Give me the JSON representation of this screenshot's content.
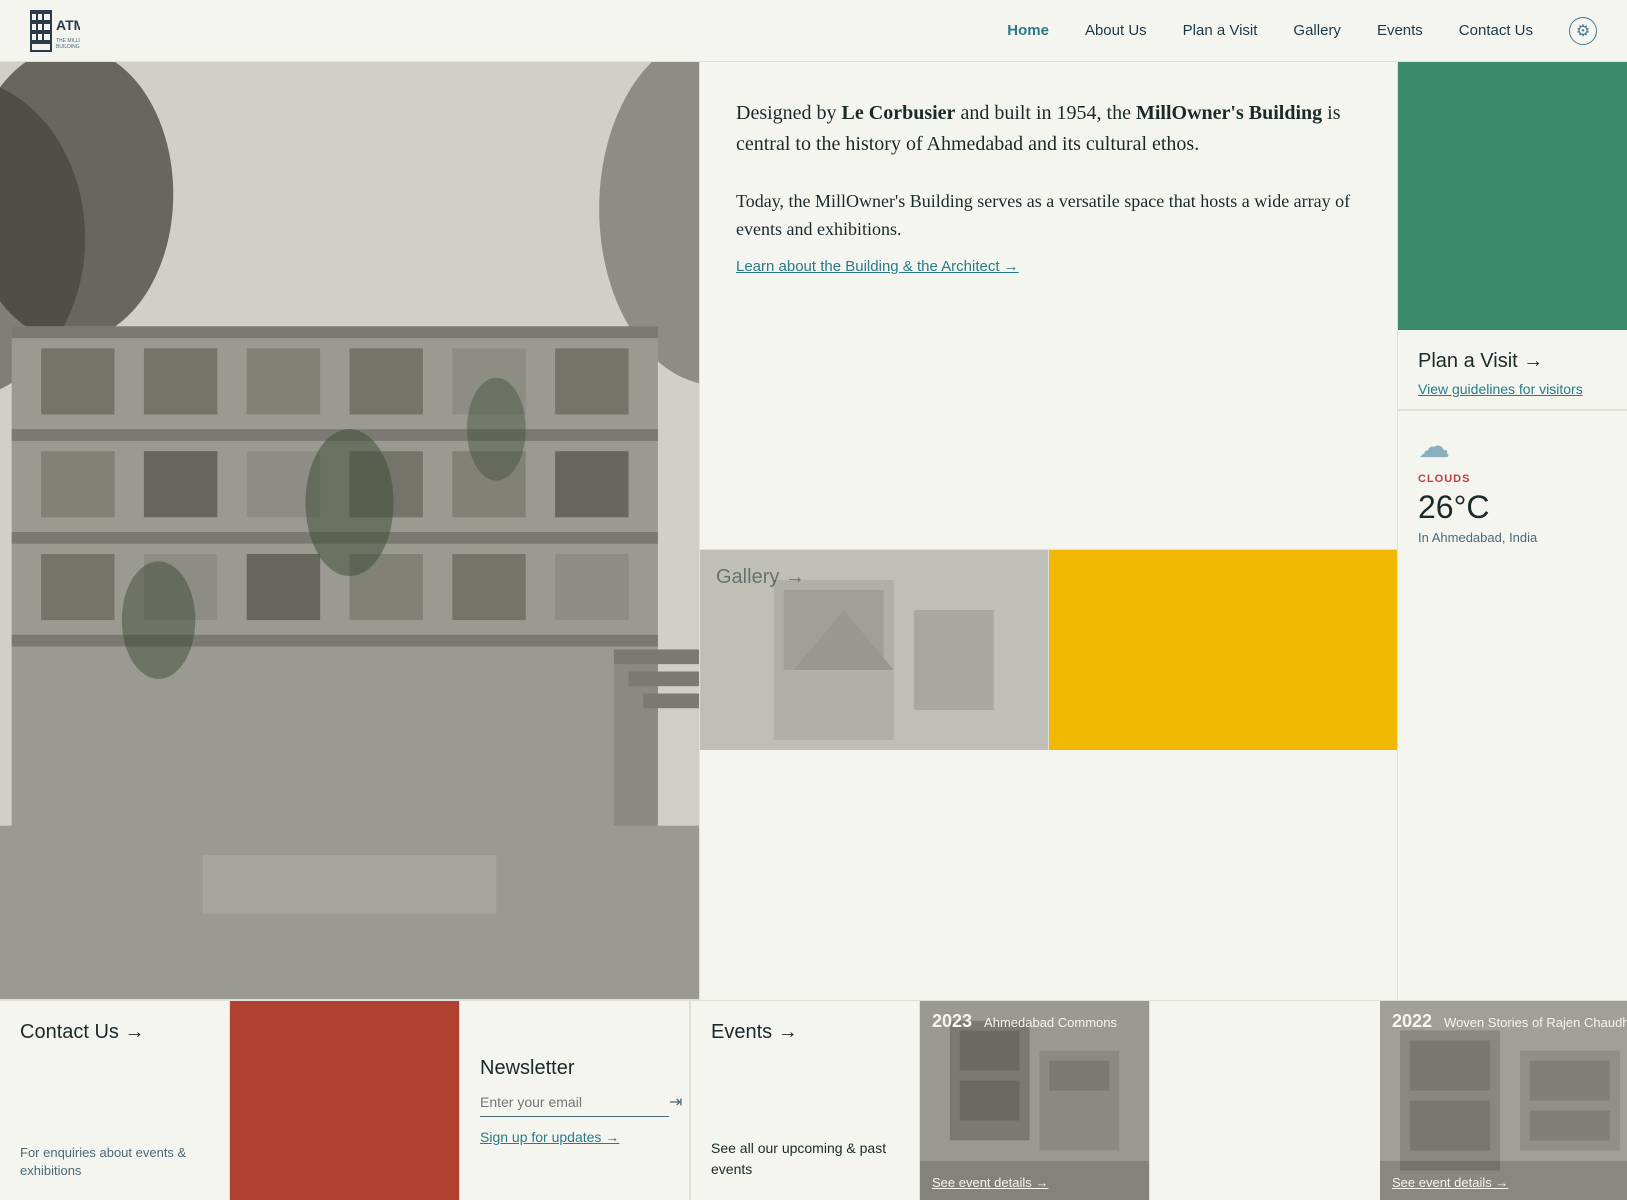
{
  "site": {
    "logo_text": "ATMA",
    "logo_subtitle": "THE MILLOWNER'S BUILDING"
  },
  "nav": {
    "items": [
      {
        "label": "Home",
        "active": true
      },
      {
        "label": "About Us",
        "active": false
      },
      {
        "label": "Plan a Visit",
        "active": false
      },
      {
        "label": "Gallery",
        "active": false
      },
      {
        "label": "Events",
        "active": false
      },
      {
        "label": "Contact Us",
        "active": false
      }
    ]
  },
  "hero": {
    "description_1_pre": "Designed by ",
    "description_1_bold1": "Le Corbusier",
    "description_1_mid": " and built in 1954, the ",
    "description_1_bold2": "MillOwner's Building",
    "description_1_post": " is central to the history of Ahmedabad and its cultural ethos.",
    "description_2": "Today, the MillOwner's Building serves as a versatile space that hosts a wide array of events and exhibitions.",
    "learn_link": "Learn about the Building & the Architect →"
  },
  "gallery": {
    "label": "Gallery →"
  },
  "plan_visit": {
    "title": "Plan a Visit →",
    "guidelines": "View guidelines for visitors"
  },
  "weather": {
    "icon": "☁",
    "label": "CLOUDS",
    "temperature": "26°C",
    "location": "In Ahmedabad, India"
  },
  "contact": {
    "title": "Contact Us →",
    "subtitle": "For enquiries about events & exhibitions"
  },
  "newsletter": {
    "title": "Newsletter",
    "email_placeholder": "Enter your email",
    "signup_label": "Sign up for updates →"
  },
  "events": {
    "title": "Events →",
    "see_all": "See all our upcoming & past events"
  },
  "event_cards": [
    {
      "year": "2023",
      "name": "Ahmedabad Commons",
      "details_link": "See event details →"
    },
    {
      "year": "2022",
      "name": "Woven Stories of Rajen Chaudhri",
      "details_link": "See event details →"
    }
  ]
}
